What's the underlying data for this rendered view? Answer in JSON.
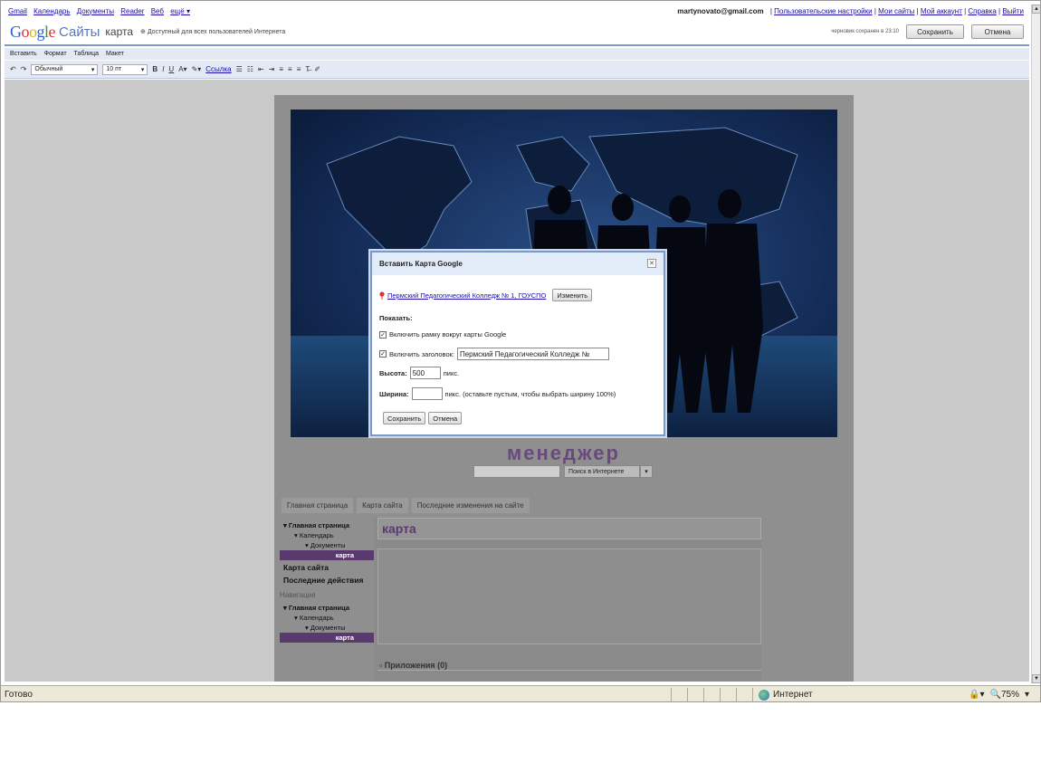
{
  "gbar": {
    "links": [
      "Gmail",
      "Календарь",
      "Документы",
      "Reader",
      "Веб",
      "ещё ▾"
    ],
    "email": "martynovato@gmail.com",
    "right_links": [
      "Пользовательские настройки",
      "Мои сайты",
      "Мой аккаунт",
      "Справка",
      "Выйти"
    ]
  },
  "header": {
    "sites": "Сайты",
    "page_name": "карта",
    "access": "Доступный для всех пользователей Интернета",
    "draft": "черновик сохранен в 23:10",
    "save": "Сохранить",
    "cancel": "Отмена"
  },
  "menubar": [
    "Вставить",
    "Формат",
    "Таблица",
    "Макет"
  ],
  "toolbar": {
    "style": "Обычный",
    "size": "10 пт",
    "link": "Ссылка"
  },
  "site": {
    "brand": "менеджер",
    "search_button": "Поиск в Интернете",
    "tabs": [
      "Главная страница",
      "Карта сайта",
      "Последние изменения на сайте"
    ],
    "sidebar": {
      "home": "▾ Главная страница",
      "calendar": "▾ Календарь",
      "docs": "▾ Документы",
      "map": "карта",
      "sitemap": "Карта сайта",
      "recent": "Последние действия",
      "nav_heading": "Навигация",
      "home2": "▾ Главная страница",
      "calendar2": "▾ Календарь",
      "docs2": "▾ Документы",
      "map2": "карта"
    },
    "main_title": "карта",
    "apps": "Приложения (0)"
  },
  "dialog": {
    "title": "Вставить Карта Google",
    "location_link": "Пермский Педагогический Колледж № 1, ГОУСПО",
    "change_button": "Изменить",
    "show_label": "Показать:",
    "frame_checkbox_label": "Включить рамку вокруг карты Google",
    "header_checkbox_label": "Включить заголовок:",
    "header_value": "Пермский Педагогический Колледж №",
    "height_label": "Высота:",
    "height_value": "500",
    "height_unit": "пикс.",
    "width_label": "Ширина:",
    "width_value": "",
    "width_unit": "пикс. (оставьте пустым, чтобы выбрать ширину 100%)",
    "save_button": "Сохранить",
    "cancel_button": "Отмена"
  },
  "status": {
    "ready": "Готово",
    "zone": "Интернет",
    "zoom": "75%"
  },
  "colors": {
    "accent": "#7a9ac8",
    "arrow": "#e60000",
    "brand": "#6a4a7e"
  }
}
